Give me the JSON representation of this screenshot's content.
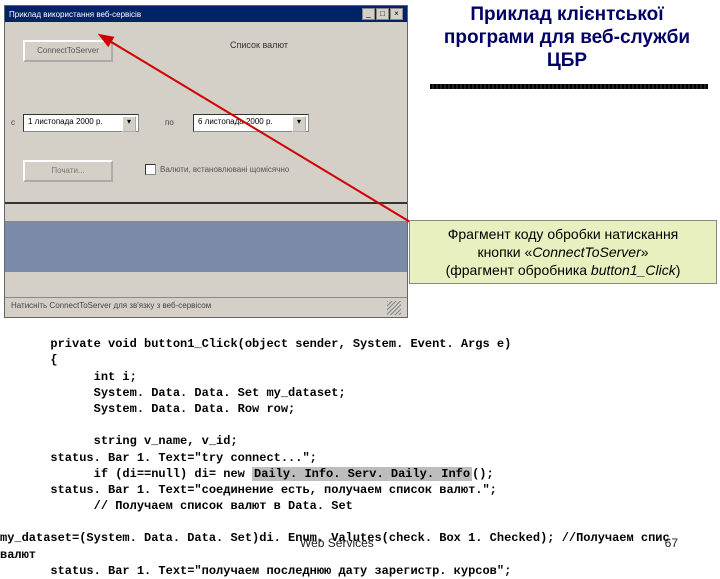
{
  "window": {
    "title": "Приклад використання веб-сервісів",
    "controls": {
      "min": "_",
      "max": "□",
      "close": "×"
    },
    "connect_btn": "ConnectToServer",
    "list_label": "Список валют",
    "col_label": "с",
    "date_from": "1 листопада 2000 р.",
    "to_label": "по",
    "date_to": "6 листопада 2000 р.",
    "ok_btn": "Почати...",
    "checkbox_label": "Валюти, встановлювані щомісячно",
    "status": "Натисніть ConnectToServer для зв'язку з веб-сервісом"
  },
  "slide": {
    "title_l1": "Приклад клієнтської",
    "title_l2": "програми для веб-служби",
    "title_l3": "ЦБР"
  },
  "caption": {
    "line1_a": "Фрагмент коду обробки натискання",
    "line1_b_pre": "кнопки «",
    "line1_b_it": "ConnectToServer",
    "line1_b_post": "»",
    "line2_pre": "(фрагмент обробника ",
    "line2_it": "button1_Click",
    "line2_post": ")"
  },
  "code": {
    "l1": "       private void button1_Click(object sender, System. Event. Args e)",
    "l2": "       {",
    "l3": "             int i;",
    "l4": "             System. Data. Data. Set my_dataset;",
    "l5": "             System. Data. Data. Row row;",
    "l6": "",
    "l7": "             string v_name, v_id;",
    "l8": "       status. Bar 1. Text=\"try connect...\";",
    "l9a": "             if (di==null) di= new ",
    "l9h": "Daily. Info. Serv. Daily. Info",
    "l9b": "();",
    "l10": "       status. Bar 1. Text=\"соединение есть, получаем список валют.\";",
    "l11": "             // Получаем список валют в Data. Set",
    "l12": "",
    "l13": "my_dataset=(System. Data. Data. Set)di. Enum. Valutes(check. Box 1. Checked); //Получаем спис",
    "l14": "валют",
    "l15": "       status. Bar 1. Text=\"получаем последнюю дату зарегистр. курсов\";"
  },
  "footer": {
    "center": "Web Services",
    "page": "67"
  }
}
